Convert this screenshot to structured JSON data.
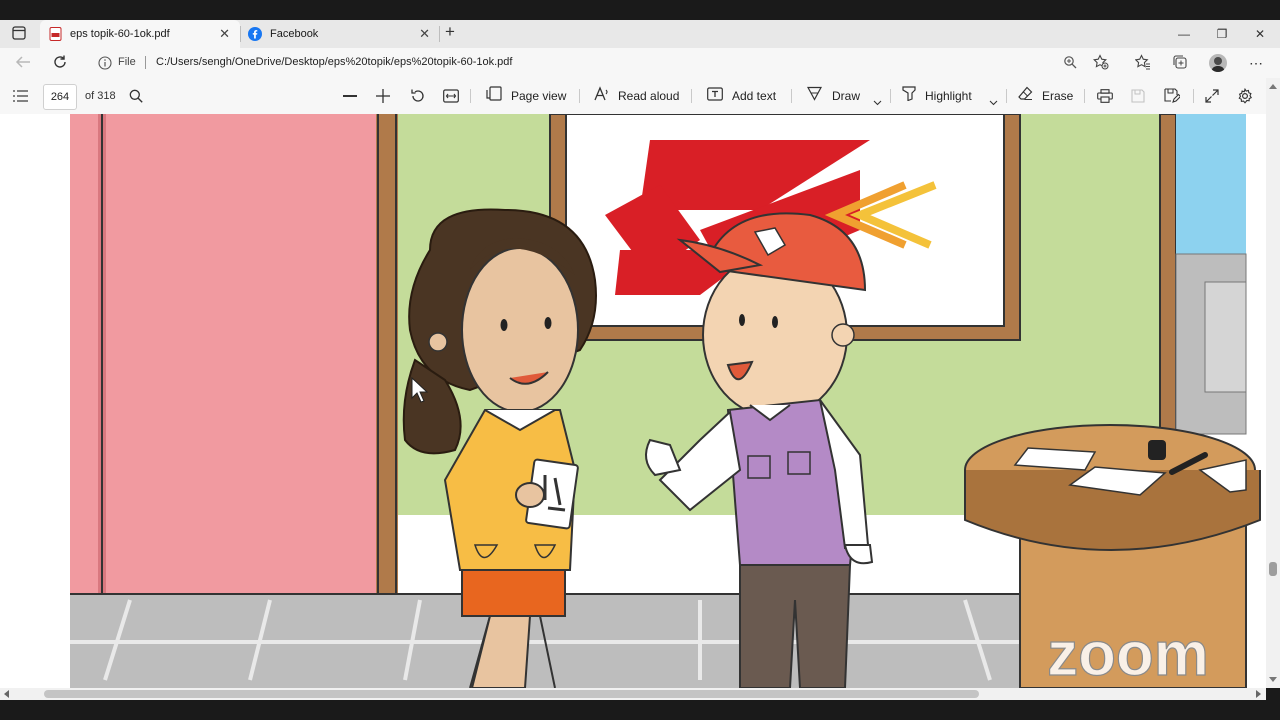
{
  "browser": {
    "tabs": [
      {
        "title": "eps topik-60-1ok.pdf",
        "icon": "pdf-icon",
        "active": true
      },
      {
        "title": "Facebook",
        "icon": "facebook-icon",
        "active": false
      }
    ],
    "new_tab_label": "+",
    "address": {
      "scheme_label": "File",
      "url": "C:/Users/sengh/OneDrive/Desktop/eps%20topik/eps%20topik-60-1ok.pdf"
    }
  },
  "pdf_toolbar": {
    "page_number": "264",
    "page_count": "of 318",
    "page_view_label": "Page view",
    "read_aloud_label": "Read aloud",
    "add_text_label": "Add text",
    "draw_label": "Draw",
    "highlight_label": "Highlight",
    "erase_label": "Erase"
  },
  "illustration": {
    "watermark": "zoom",
    "colors": {
      "wall_pink": "#f19aa0",
      "wall_green": "#c4dc9a",
      "sky_blue": "#8dd2ef",
      "floor": "#bdbdbd",
      "logo_red": "#d91f26",
      "cap": "#e85b3f",
      "vest": "#b48ac6",
      "sweater": "#f7bd45",
      "skirt": "#e8661f",
      "table": "#d39b5c"
    }
  },
  "scroll": {
    "horizontal_position": 0.11,
    "horizontal_thumb_fraction": 0.75
  }
}
